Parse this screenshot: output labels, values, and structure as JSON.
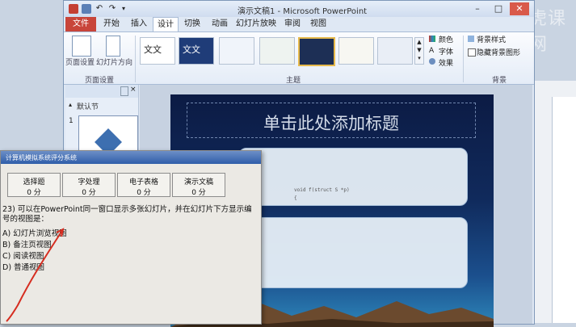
{
  "window": {
    "title": "演示文稿1 - Microsoft PowerPoint"
  },
  "tabs": [
    "文件",
    "开始",
    "插入",
    "设计",
    "切换",
    "动画",
    "幻灯片放映",
    "审阅",
    "视图"
  ],
  "ribbon": {
    "page_setup": {
      "btn1": "页面设置",
      "btn2": "幻灯片方向",
      "group": "页面设置"
    },
    "themes": {
      "group": "主题",
      "sample_text": "文文"
    },
    "theme_options": {
      "colors": "颜色",
      "fonts": "字体",
      "effects": "效果"
    },
    "background": {
      "style": "背景样式",
      "hide": "隐藏背景图形",
      "group": "背景"
    }
  },
  "thumbnails": {
    "section": "默认节",
    "slide_num": "1"
  },
  "slide": {
    "title": "单击此处添加标题",
    "code_line1": "void f(struct S  *p)",
    "code_line2": "{"
  },
  "exam": {
    "title": "计算机模拟系统评分系统",
    "categories": [
      {
        "name": "选择题",
        "score": "0 分"
      },
      {
        "name": "字处理",
        "score": "0 分"
      },
      {
        "name": "电子表格",
        "score": "0 分"
      },
      {
        "name": "演示文稿",
        "score": "0 分"
      }
    ],
    "question": "23) 可以在PowerPoint同一窗口显示多张幻灯片，并在幻灯片下方显示编号的视图是：",
    "options": [
      "A) 幻灯片浏览视图",
      "B) 备注页视图",
      "C) 阅读视图",
      "D) 普通视图"
    ]
  },
  "watermark": "虎课网"
}
